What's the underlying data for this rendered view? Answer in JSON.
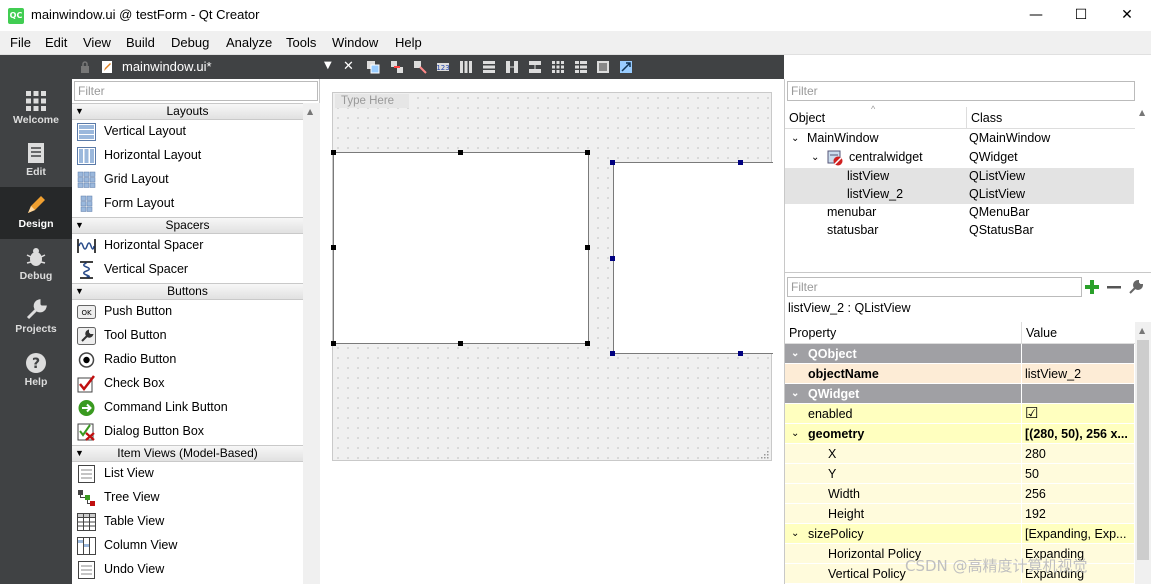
{
  "window": {
    "title": "mainwindow.ui @ testForm - Qt Creator",
    "app_icon_text": "QC",
    "controls": {
      "minimize": "—",
      "maximize": "☐",
      "close": "✕"
    }
  },
  "menubar": [
    "File",
    "Edit",
    "View",
    "Build",
    "Debug",
    "Analyze",
    "Tools",
    "Window",
    "Help"
  ],
  "modes": [
    {
      "label": "Welcome",
      "icon": "welcome-icon"
    },
    {
      "label": "Edit",
      "icon": "edit-icon"
    },
    {
      "label": "Design",
      "icon": "design-icon",
      "active": true
    },
    {
      "label": "Debug",
      "icon": "debug-icon"
    },
    {
      "label": "Projects",
      "icon": "projects-icon"
    },
    {
      "label": "Help",
      "icon": "help-icon"
    }
  ],
  "editor": {
    "document_tab": "mainwindow.ui*",
    "close_glyph": "✕"
  },
  "widget_box": {
    "filter_placeholder": "Filter",
    "categories": {
      "layouts": "Layouts",
      "spacers": "Spacers",
      "buttons": "Buttons",
      "item_views": "Item Views (Model-Based)"
    },
    "items": {
      "vertical_layout": "Vertical Layout",
      "horizontal_layout": "Horizontal Layout",
      "grid_layout": "Grid Layout",
      "form_layout": "Form Layout",
      "horizontal_spacer": "Horizontal Spacer",
      "vertical_spacer": "Vertical Spacer",
      "push_button": "Push Button",
      "tool_button": "Tool Button",
      "radio_button": "Radio Button",
      "check_box": "Check Box",
      "command_link_button": "Command Link Button",
      "dialog_button_box": "Dialog Button Box",
      "list_view": "List View",
      "tree_view": "Tree View",
      "table_view": "Table View",
      "column_view": "Column View",
      "undo_view": "Undo View"
    },
    "push_button_icon_text": "OK"
  },
  "form": {
    "type_here": "Type Here"
  },
  "object_inspector": {
    "filter_placeholder": "Filter",
    "columns": {
      "object": "Object",
      "class": "Class"
    },
    "rows": [
      {
        "object": "MainWindow",
        "class": "QMainWindow"
      },
      {
        "object": "centralwidget",
        "class": "QWidget"
      },
      {
        "object": "listView",
        "class": "QListView"
      },
      {
        "object": "listView_2",
        "class": "QListView"
      },
      {
        "object": "menubar",
        "class": "QMenuBar"
      },
      {
        "object": "statusbar",
        "class": "QStatusBar"
      }
    ]
  },
  "property_editor": {
    "filter_placeholder": "Filter",
    "title": "listView_2 : QListView",
    "columns": {
      "property": "Property",
      "value": "Value"
    },
    "groups": {
      "qobject": "QObject",
      "qwidget": "QWidget"
    },
    "props": {
      "objectName": {
        "name": "objectName",
        "value": "listView_2"
      },
      "enabled": {
        "name": "enabled",
        "value": "☑"
      },
      "geometry": {
        "name": "geometry",
        "value": "[(280, 50), 256 x..."
      },
      "x": {
        "name": "X",
        "value": "280"
      },
      "y": {
        "name": "Y",
        "value": "50"
      },
      "width": {
        "name": "Width",
        "value": "256"
      },
      "height": {
        "name": "Height",
        "value": "192"
      },
      "sizePolicy": {
        "name": "sizePolicy",
        "value": "[Expanding, Exp..."
      },
      "hpolicy": {
        "name": "Horizontal Policy",
        "value": "Expanding"
      },
      "vpolicy": {
        "name": "Vertical Policy",
        "value": "Expanding"
      }
    }
  },
  "watermark": "CSDN @高精度计算机视觉",
  "colors": {
    "dark_bar": "#404244",
    "active_mode": "#262829",
    "group_row": "#a0a0a4",
    "prop_yellow": "#ffffbf",
    "selected_row": "#fdecd6"
  }
}
